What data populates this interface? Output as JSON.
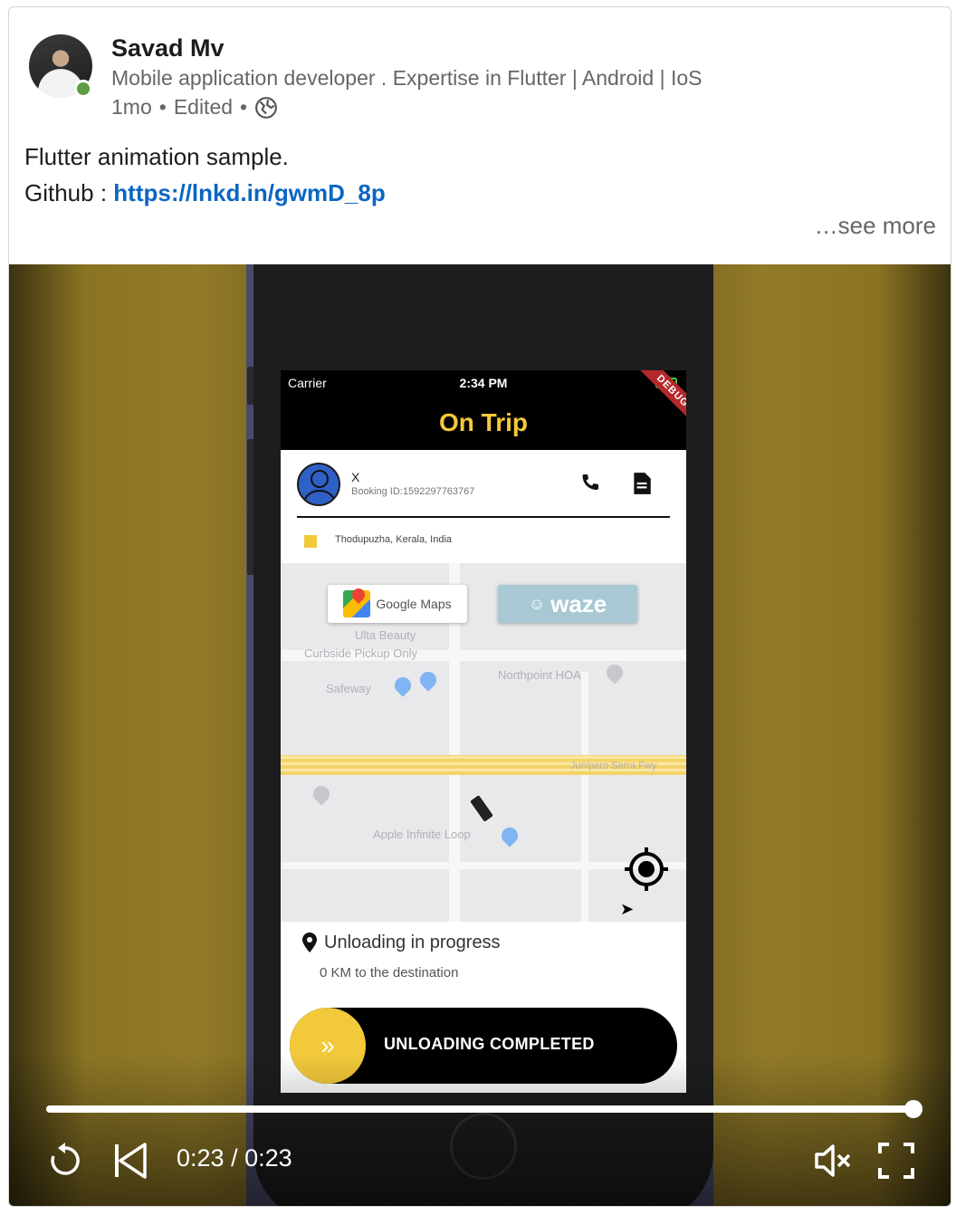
{
  "author": {
    "name": "Savad Mv",
    "headline": "Mobile application developer . Expertise in Flutter | Android | IoS",
    "time": "1mo",
    "edited": "Edited"
  },
  "post": {
    "text": "Flutter animation sample.",
    "github_label": "Github : ",
    "link": "https://lnkd.in/gwmD_8p",
    "see_more": "…see more"
  },
  "app": {
    "carrier": "Carrier",
    "clock": "2:34 PM",
    "debug": "DEBUG",
    "title": "On Trip",
    "passenger_name": "X",
    "booking_id": "Booking ID:1592297763767",
    "pickup_address": "Thodupuzha, Kerala, India",
    "gmaps_label": "Google Maps",
    "waze_label": "waze",
    "map_labels": [
      "Ulta Beauty",
      "Curbside Pickup Only",
      "Safeway",
      "Northpoint HOA",
      "Junipero Serra Fwy",
      "Apple Infinite Loop"
    ],
    "trip_status": "Unloading in progress",
    "distance": "0 KM to the destination",
    "slide_label": "UNLOADING COMPLETED",
    "slide_knob": "»"
  },
  "video": {
    "current_time": "0:23",
    "duration": "0:23",
    "progress": 1.0
  },
  "colors": {
    "accent_yellow": "#f2c93a",
    "link_blue": "#0a66c2",
    "online_green": "#5f9b41"
  },
  "icons": [
    "globe-icon",
    "phone-icon",
    "note-icon",
    "locate-icon",
    "pin-icon",
    "replay-icon",
    "skip-back-icon",
    "mute-icon",
    "fullscreen-icon"
  ]
}
